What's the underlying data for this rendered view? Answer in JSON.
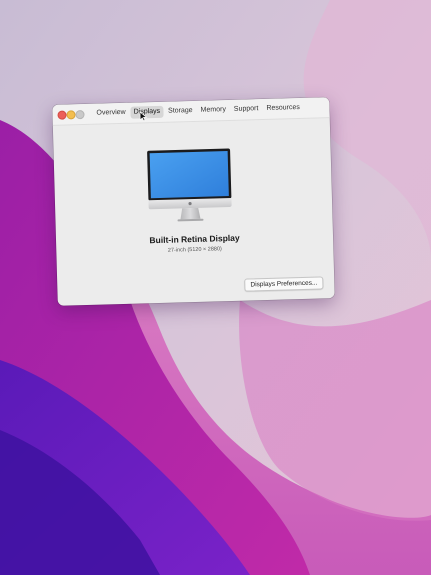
{
  "window": {
    "tabs": [
      {
        "label": "Overview"
      },
      {
        "label": "Displays"
      },
      {
        "label": "Storage"
      },
      {
        "label": "Memory"
      },
      {
        "label": "Support"
      },
      {
        "label": "Resources"
      }
    ],
    "active_tab": "Displays"
  },
  "display": {
    "name": "Built-in Retina Display",
    "spec": "27-inch (5120 × 2880)"
  },
  "buttons": {
    "preferences_label": "Displays Preferences..."
  },
  "colors": {
    "accent_blue": "#3d8ee6",
    "close": "#ec5f59",
    "minimize": "#f3be4f"
  },
  "icons": {
    "device": "imac-icon",
    "pointer": "cursor-icon"
  }
}
